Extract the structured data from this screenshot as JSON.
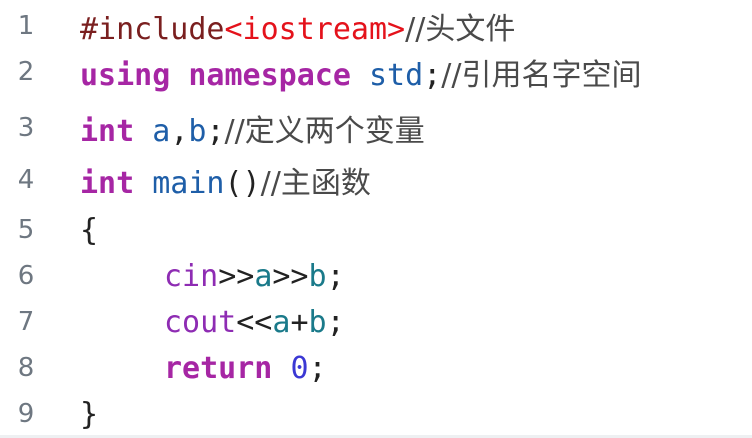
{
  "lines": [
    {
      "n": "1",
      "t": [
        {
          "c": "dir",
          "v": "#include"
        },
        {
          "c": "inc",
          "v": "<iostream>"
        },
        {
          "c": "cm",
          "v": "//头文件"
        }
      ]
    },
    {
      "n": "2",
      "t": [
        {
          "c": "kw",
          "v": "using namespace"
        },
        {
          "c": "pn",
          "v": " "
        },
        {
          "c": "id",
          "v": "std"
        },
        {
          "c": "pn",
          "v": ";"
        },
        {
          "c": "cm",
          "v": "//引用名字空间"
        }
      ]
    },
    {
      "n": "3",
      "t": [
        {
          "c": "kw",
          "v": "int"
        },
        {
          "c": "pn",
          "v": " "
        },
        {
          "c": "id",
          "v": "a"
        },
        {
          "c": "pn",
          "v": ","
        },
        {
          "c": "id",
          "v": "b"
        },
        {
          "c": "pn",
          "v": ";"
        },
        {
          "c": "cm",
          "v": "//定义两个变量"
        }
      ]
    },
    {
      "n": "4",
      "t": [
        {
          "c": "kw",
          "v": "int"
        },
        {
          "c": "pn",
          "v": " "
        },
        {
          "c": "fn",
          "v": "main"
        },
        {
          "c": "pn",
          "v": "()"
        },
        {
          "c": "cm",
          "v": "//主函数"
        }
      ]
    },
    {
      "n": "5",
      "t": [
        {
          "c": "pn",
          "v": "{"
        }
      ]
    },
    {
      "n": "6",
      "i": true,
      "t": [
        {
          "c": "io",
          "v": "cin"
        },
        {
          "c": "pn",
          "v": ">>"
        },
        {
          "c": "var",
          "v": "a"
        },
        {
          "c": "pn",
          "v": ">>"
        },
        {
          "c": "var",
          "v": "b"
        },
        {
          "c": "pn",
          "v": ";"
        }
      ]
    },
    {
      "n": "7",
      "i": true,
      "t": [
        {
          "c": "io",
          "v": "cout"
        },
        {
          "c": "pn",
          "v": "<<"
        },
        {
          "c": "var",
          "v": "a"
        },
        {
          "c": "pn",
          "v": "+"
        },
        {
          "c": "var",
          "v": "b"
        },
        {
          "c": "pn",
          "v": ";"
        }
      ]
    },
    {
      "n": "8",
      "i": true,
      "t": [
        {
          "c": "kw",
          "v": "return"
        },
        {
          "c": "pn",
          "v": " "
        },
        {
          "c": "num",
          "v": "0"
        },
        {
          "c": "pn",
          "v": ";"
        }
      ]
    },
    {
      "n": "9",
      "t": [
        {
          "c": "pn",
          "v": "}"
        }
      ]
    }
  ]
}
